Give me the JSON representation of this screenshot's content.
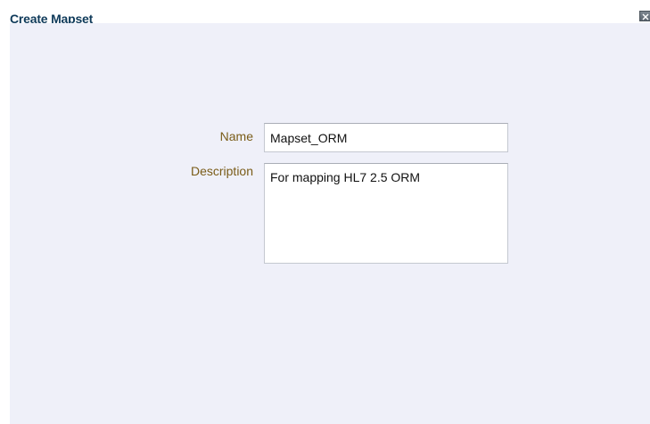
{
  "dialog": {
    "title": "Create Mapset",
    "close_icon": "close-icon"
  },
  "form": {
    "name_label": "Name",
    "name_value": "Mapset_ORM",
    "description_label": "Description",
    "description_value": "For mapping HL7 2.5 ORM"
  },
  "colors": {
    "title": "#0f3a5a",
    "label": "#7a5c18",
    "body_background": "#eff0f9"
  }
}
